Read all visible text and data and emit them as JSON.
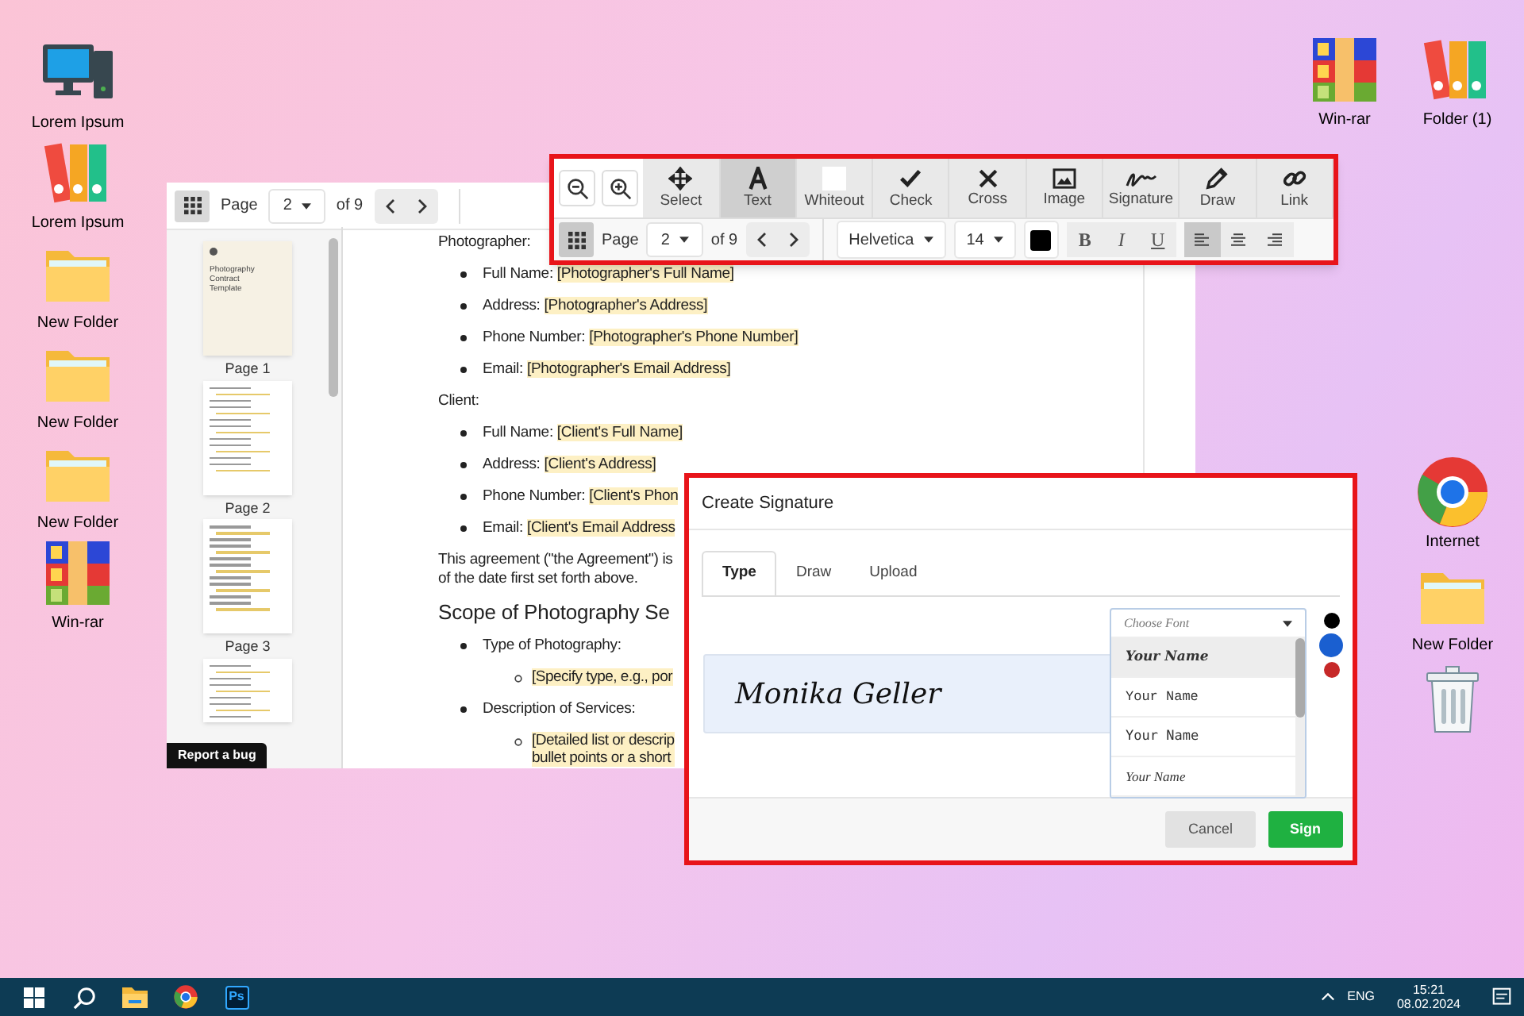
{
  "desktop": {
    "left_icons": [
      {
        "label": "Lorem Ipsum",
        "kind": "computer"
      },
      {
        "label": "Lorem Ipsum",
        "kind": "binders"
      },
      {
        "label": "New Folder",
        "kind": "folder"
      },
      {
        "label": "New Folder",
        "kind": "folder"
      },
      {
        "label": "New Folder",
        "kind": "folder"
      },
      {
        "label": "Win-rar",
        "kind": "winrar"
      }
    ],
    "right_top_icons": [
      {
        "label": "Win-rar",
        "kind": "winrar"
      },
      {
        "label": "Folder (1)",
        "kind": "binders"
      }
    ],
    "right_icons": [
      {
        "label": "Internet",
        "kind": "chrome"
      },
      {
        "label": "New Folder",
        "kind": "folder"
      },
      {
        "kind": "trash"
      }
    ]
  },
  "viewer": {
    "page_label": "Page",
    "page_value": "2",
    "page_total": "of 9",
    "thumbnails": [
      {
        "label": "Page 1",
        "kind": "cover",
        "title": "Photography Contract Template"
      },
      {
        "label": "Page 2",
        "kind": "text"
      },
      {
        "label": "Page 3",
        "kind": "text"
      },
      {
        "kind": "text"
      }
    ],
    "report_button": "Report a bug",
    "document": [
      {
        "kind": "paragraph",
        "lines": [
          "Photographer:"
        ]
      },
      {
        "kind": "bullet",
        "label": "Full Name:",
        "value": "[Photographer's Full Name]"
      },
      {
        "kind": "bullet",
        "label": "Address:",
        "value": "[Photographer's Address]"
      },
      {
        "kind": "bullet",
        "label": "Phone Number:",
        "value": "[Photographer's Phone Number]"
      },
      {
        "kind": "bullet",
        "label": "Email:",
        "value": "[Photographer's Email Address]"
      },
      {
        "kind": "paragraph",
        "lines": [
          "Client:"
        ]
      },
      {
        "kind": "bullet",
        "label": "Full Name:",
        "value": "[Client's Full Name]"
      },
      {
        "kind": "bullet",
        "label": "Address:",
        "value": "[Client's Address]"
      },
      {
        "kind": "bullet",
        "label": "Phone Number:",
        "value": "[Client's Phon"
      },
      {
        "kind": "bullet",
        "label": "Email:",
        "value": "[Client's Email Address"
      },
      {
        "kind": "paragraph",
        "lines": [
          "This agreement (\"the Agreement\") is",
          "of the date first set forth above."
        ]
      },
      {
        "kind": "heading",
        "lines": [
          "Scope of Photography Se"
        ]
      },
      {
        "kind": "bullet",
        "label": "Type of Photography:"
      },
      {
        "kind": "subbullet",
        "lines": [
          "[Specify type, e.g., por"
        ]
      },
      {
        "kind": "bullet",
        "label": "Description of Services:"
      },
      {
        "kind": "subbullet",
        "lines": [
          "[Detailed list or descrip",
          "bullet points or a short"
        ]
      }
    ]
  },
  "toolbar": {
    "tools": [
      {
        "label": "Select",
        "kind": "move",
        "selected": false
      },
      {
        "label": "Text",
        "kind": "text",
        "selected": true
      },
      {
        "label": "Whiteout",
        "kind": "whiteout",
        "selected": false
      },
      {
        "label": "Check",
        "kind": "check",
        "selected": false
      },
      {
        "label": "Cross",
        "kind": "cross",
        "selected": false
      },
      {
        "label": "Image",
        "kind": "image",
        "selected": false
      },
      {
        "label": "Signature",
        "kind": "signature",
        "selected": false
      },
      {
        "label": "Draw",
        "kind": "draw",
        "selected": false
      },
      {
        "label": "Link",
        "kind": "link",
        "selected": false
      }
    ],
    "page_label": "Page",
    "page_value": "2",
    "page_total": "of 9",
    "font": "Helvetica",
    "size": "14",
    "format": [
      {
        "label": "B",
        "selected": false
      },
      {
        "label": "I",
        "selected": false
      },
      {
        "label": "U",
        "selected": false
      }
    ],
    "align": [
      {
        "kind": "left",
        "selected": true
      },
      {
        "kind": "center",
        "selected": false
      },
      {
        "kind": "right",
        "selected": false
      }
    ]
  },
  "dialog": {
    "title": "Create Signature",
    "tabs": [
      {
        "label": "Type",
        "selected": true
      },
      {
        "label": "Draw",
        "selected": false
      },
      {
        "label": "Upload",
        "selected": false
      }
    ],
    "signature": "Monika Geller",
    "font_field": {
      "placeholder": "Choose Font"
    },
    "font_options": [
      {
        "label": "Your Name",
        "selected": true
      },
      {
        "label": "Your Name",
        "selected": false
      },
      {
        "label": "Your Name",
        "selected": false
      },
      {
        "label": "Your Name",
        "selected": false
      }
    ],
    "colors": [
      {
        "color": "#000000",
        "selected": false
      },
      {
        "color": "#1a5fd0",
        "selected": true
      },
      {
        "color": "#c62828",
        "selected": false
      }
    ],
    "buttons": [
      {
        "label": "Cancel",
        "kind": "secondary"
      },
      {
        "label": "Sign",
        "kind": "primary"
      }
    ]
  },
  "taskbar": {
    "apps": [
      {
        "kind": "start"
      },
      {
        "kind": "search"
      },
      {
        "kind": "explorer"
      },
      {
        "kind": "chrome"
      },
      {
        "kind": "photoshop",
        "label": "Ps"
      }
    ],
    "language": "ENG",
    "time": "15:21",
    "date": "08.02.2024"
  }
}
